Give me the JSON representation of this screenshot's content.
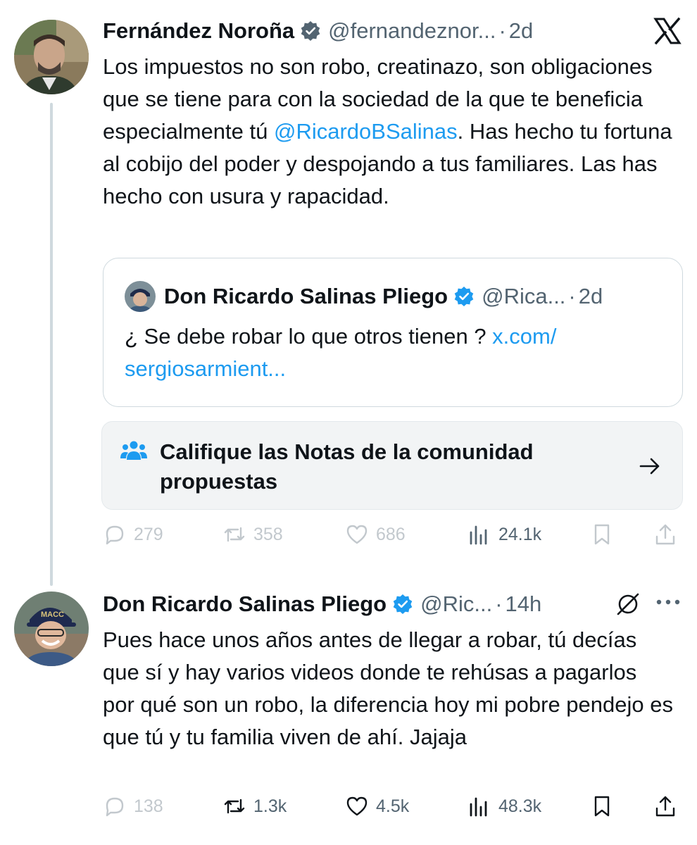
{
  "tweet1": {
    "name": "Fernández Noroña",
    "handle": "@fernandeznor...",
    "dot": "·",
    "time": "2d",
    "text_before_mention": "Los impuestos no son robo, creatinazo, son obligaciones que se tiene para con la sociedad de la que te beneficia especialmente tú ",
    "mention": "@RicardoBSalinas",
    "text_after_mention": ". Has hecho tu fortuna al cobijo del poder y despojando a tus familiares. Las has hecho con usura y rapacidad.",
    "quote": {
      "name": "Don Ricardo Salinas Pliego",
      "handle": "@Rica...",
      "dot": "·",
      "time": "2d",
      "text": "¿ Se debe robar lo que otros tienen ? ",
      "link": "x.com/ sergiosarmient..."
    },
    "community_notes": {
      "label": "Califique las Notas de la comunidad propuestas"
    },
    "actions": {
      "replies": "279",
      "reposts": "358",
      "likes": "686",
      "views": "24.1k"
    }
  },
  "tweet2": {
    "name": "Don Ricardo Salinas Pliego",
    "handle": "@Ric...",
    "dot": "·",
    "time": "14h",
    "text": "Pues hace unos años antes de llegar a robar, tú decías que sí y hay varios videos donde te rehúsas a pagarlos por qué son un robo, la diferencia hoy mi pobre pendejo es que tú y tu familia viven de ahí. Jajaja",
    "actions": {
      "replies": "138",
      "reposts": "1.3k",
      "likes": "4.5k",
      "views": "48.3k"
    }
  },
  "icons": {
    "brand": "x-logo-icon",
    "verified": "verified-badge-icon",
    "reply": "reply-icon",
    "repost": "repost-icon",
    "like": "heart-icon",
    "views": "views-bar-chart-icon",
    "bookmark": "bookmark-icon",
    "share": "share-icon",
    "notes": "community-notes-icon",
    "arrow": "arrow-right-icon",
    "more": "more-dots-icon",
    "not_interested": "no-symbol-icon"
  },
  "colors": {
    "accent": "#1d9bf0",
    "text": "#0f1419",
    "muted": "#536471",
    "border": "#cfd9de"
  }
}
